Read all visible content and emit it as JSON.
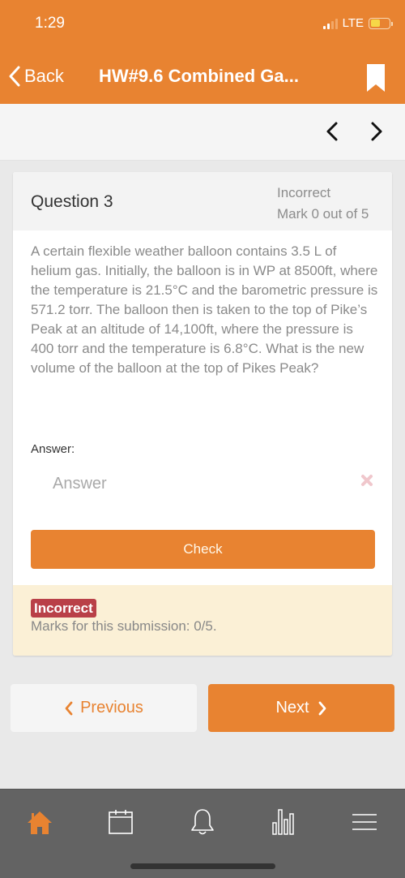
{
  "status_bar": {
    "time": "1:29",
    "network": "LTE",
    "signal_bars_active": 2,
    "signal_bars_total": 4,
    "battery_level_percent": 50
  },
  "nav": {
    "back_label": "Back",
    "title": "HW#9.6 Combined Ga...",
    "bookmark_icon": "bookmark-icon"
  },
  "pager": {
    "prev_icon": "chevron-left-icon",
    "next_icon": "chevron-right-icon"
  },
  "question": {
    "title": "Question 3",
    "state": "Incorrect",
    "mark": "Mark 0 out of 5",
    "text": "A certain flexible weather balloon contains 3.5 L of helium gas. Initially, the balloon is in WP at 8500ft, where the temperature is 21.5°C and the barometric pressure is 571.2 torr. The balloon then is taken to the top of Pike’s Peak at an altitude of 14,100ft, where the pressure is 400 torr and the temperature is 6.8°C. What is the new volume of the balloon at the top of Pikes Peak?",
    "answer_label": "Answer:",
    "answer_value": "",
    "answer_placeholder": "Answer",
    "check_label": "Check"
  },
  "feedback": {
    "badge": "Incorrect",
    "marks": "Marks for this submission: 0/5."
  },
  "navigation": {
    "previous_label": "Previous",
    "next_label": "Next"
  },
  "tabbar": {
    "items": [
      {
        "name": "home",
        "icon": "home-icon",
        "active": true
      },
      {
        "name": "calendar",
        "icon": "calendar-icon",
        "active": false
      },
      {
        "name": "notifications",
        "icon": "bell-icon",
        "active": false
      },
      {
        "name": "grades",
        "icon": "bar-chart-icon",
        "active": false
      },
      {
        "name": "menu",
        "icon": "hamburger-menu-icon",
        "active": false
      }
    ]
  },
  "colors": {
    "brand": "#e88331",
    "incorrect_badge": "#b94048",
    "feedback_bg": "#fbf0d6",
    "tabbar_bg": "#636363"
  }
}
